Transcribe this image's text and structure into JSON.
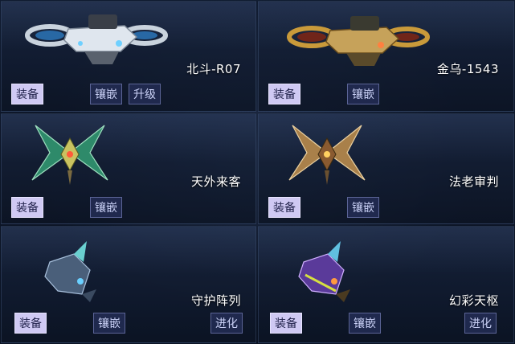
{
  "cards": [
    {
      "name": "北斗-R07",
      "buttons": {
        "equip": "装备",
        "inlay": "镶嵌",
        "upgrade": "升级"
      }
    },
    {
      "name": "金乌-1543",
      "buttons": {
        "equip": "装备",
        "inlay": "镶嵌"
      }
    },
    {
      "name": "天外来客",
      "buttons": {
        "equip": "装备",
        "inlay": "镶嵌"
      }
    },
    {
      "name": "法老审判",
      "buttons": {
        "equip": "装备",
        "inlay": "镶嵌"
      }
    },
    {
      "name": "守护阵列",
      "buttons": {
        "equip": "装备",
        "inlay": "镶嵌",
        "evolve": "进化"
      }
    },
    {
      "name": "幻彩天枢",
      "buttons": {
        "equip": "装备",
        "inlay": "镶嵌",
        "evolve": "进化"
      }
    }
  ],
  "icons": [
    "drone-silver-icon",
    "drone-gold-icon",
    "wing-pet-green-icon",
    "wing-pet-gold-icon",
    "mech-pet-blue-icon",
    "mech-pet-purple-icon"
  ],
  "colors": {
    "equip_button": "#cfc9f3",
    "secondary_button": "#232d55",
    "panel_bg": "#0c1526"
  }
}
